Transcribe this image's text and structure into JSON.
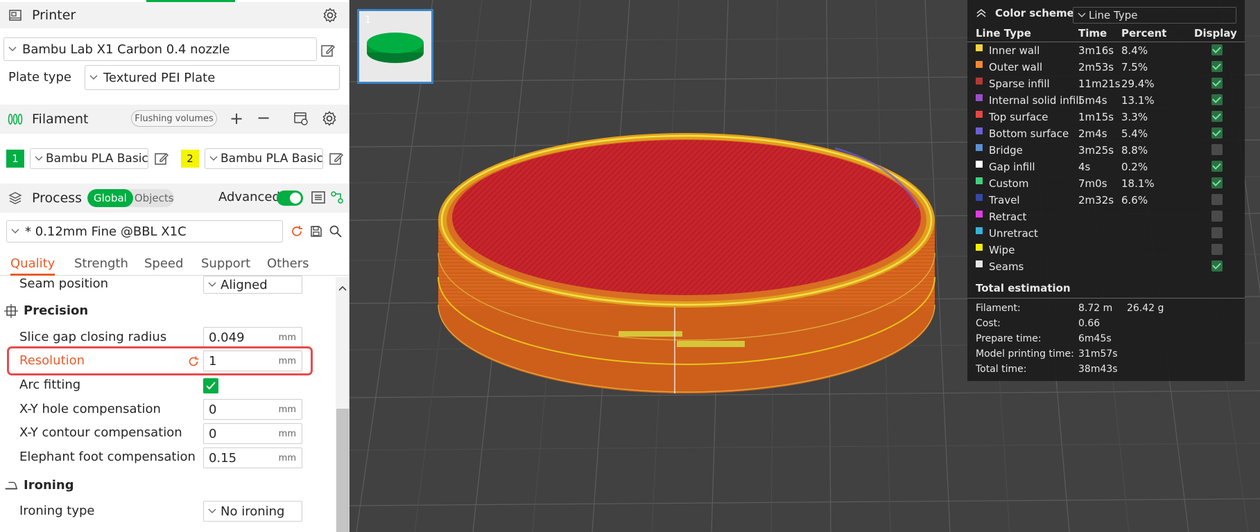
{
  "printer": {
    "title": "Printer",
    "model": "Bambu Lab X1 Carbon 0.4 nozzle",
    "plate_label": "Plate type",
    "plate_value": "Textured PEI Plate"
  },
  "filament": {
    "title": "Filament",
    "flush_label": "Flushing volumes",
    "slots": [
      {
        "num": "1",
        "color": "#00ae42",
        "num_color": "#ffffff",
        "name": "Bambu PLA Basic"
      },
      {
        "num": "2",
        "color": "#f5f500",
        "num_color": "#262626",
        "name": "Bambu PLA Basic"
      }
    ]
  },
  "process": {
    "title": "Process",
    "seg_global": "Global",
    "seg_objects": "Objects",
    "advanced_label": "Advanced",
    "profile": "* 0.12mm Fine @BBL X1C"
  },
  "tabs": [
    "Quality",
    "Strength",
    "Speed",
    "Support",
    "Others"
  ],
  "quality": {
    "seam_label": "Seam position",
    "seam_value": "Aligned",
    "precision_title": "Precision",
    "slice_gap_label": "Slice gap closing radius",
    "slice_gap_value": "0.049",
    "resolution_label": "Resolution",
    "resolution_value": "1",
    "arc_label": "Arc fitting",
    "xy_hole_label": "X-Y hole compensation",
    "xy_hole_value": "0",
    "xy_contour_label": "X-Y contour compensation",
    "xy_contour_value": "0",
    "elephant_label": "Elephant foot compensation",
    "elephant_value": "0.15",
    "unit": "mm",
    "ironing_title": "Ironing",
    "ironing_type_label": "Ironing type",
    "ironing_type_value": "No ironing"
  },
  "viewport": {
    "plate_num": "1"
  },
  "legend": {
    "title": "Color scheme",
    "scheme": "Line Type",
    "col_line": "Line Type",
    "col_time": "Time",
    "col_percent": "Percent",
    "col_display": "Display",
    "rows": [
      {
        "name": "Inner wall",
        "color": "#f2d43b",
        "time": "3m16s",
        "pct": "8.4%",
        "on": true
      },
      {
        "name": "Outer wall",
        "color": "#f08a32",
        "time": "2m53s",
        "pct": "7.5%",
        "on": true
      },
      {
        "name": "Sparse infill",
        "color": "#b23a32",
        "time": "11m21s",
        "pct": "29.4%",
        "on": true
      },
      {
        "name": "Internal solid infill",
        "color": "#9a4fc7",
        "time": "5m4s",
        "pct": "13.1%",
        "on": true
      },
      {
        "name": "Top surface",
        "color": "#e64646",
        "time": "1m15s",
        "pct": "3.3%",
        "on": true
      },
      {
        "name": "Bottom surface",
        "color": "#6a5fd6",
        "time": "2m4s",
        "pct": "5.4%",
        "on": true
      },
      {
        "name": "Bridge",
        "color": "#5b8fd4",
        "time": "3m25s",
        "pct": "8.8%",
        "on": false
      },
      {
        "name": "Gap infill",
        "color": "#ffffff",
        "time": "4s",
        "pct": "0.2%",
        "on": true
      },
      {
        "name": "Custom",
        "color": "#3fd17e",
        "time": "7m0s",
        "pct": "18.1%",
        "on": true
      },
      {
        "name": "Travel",
        "color": "#3348a8",
        "time": "2m32s",
        "pct": "6.6%",
        "on": false
      },
      {
        "name": "Retract",
        "color": "#e23ae6",
        "time": "",
        "pct": "",
        "on": false
      },
      {
        "name": "Unretract",
        "color": "#38b2d9",
        "time": "",
        "pct": "",
        "on": false
      },
      {
        "name": "Wipe",
        "color": "#f6f000",
        "time": "",
        "pct": "",
        "on": false
      },
      {
        "name": "Seams",
        "color": "#e6e6e6",
        "time": "",
        "pct": "",
        "on": true
      }
    ],
    "total_title": "Total estimation",
    "estimation": [
      {
        "label": "Filament:",
        "value": "8.72 m",
        "extra": "26.42 g"
      },
      {
        "label": "Cost:",
        "value": "0.66",
        "extra": ""
      },
      {
        "label": "Prepare time:",
        "value": "6m45s",
        "extra": ""
      },
      {
        "label": "Model printing time:",
        "value": "31m57s",
        "extra": ""
      },
      {
        "label": "Total time:",
        "value": "38m43s",
        "extra": ""
      }
    ]
  }
}
